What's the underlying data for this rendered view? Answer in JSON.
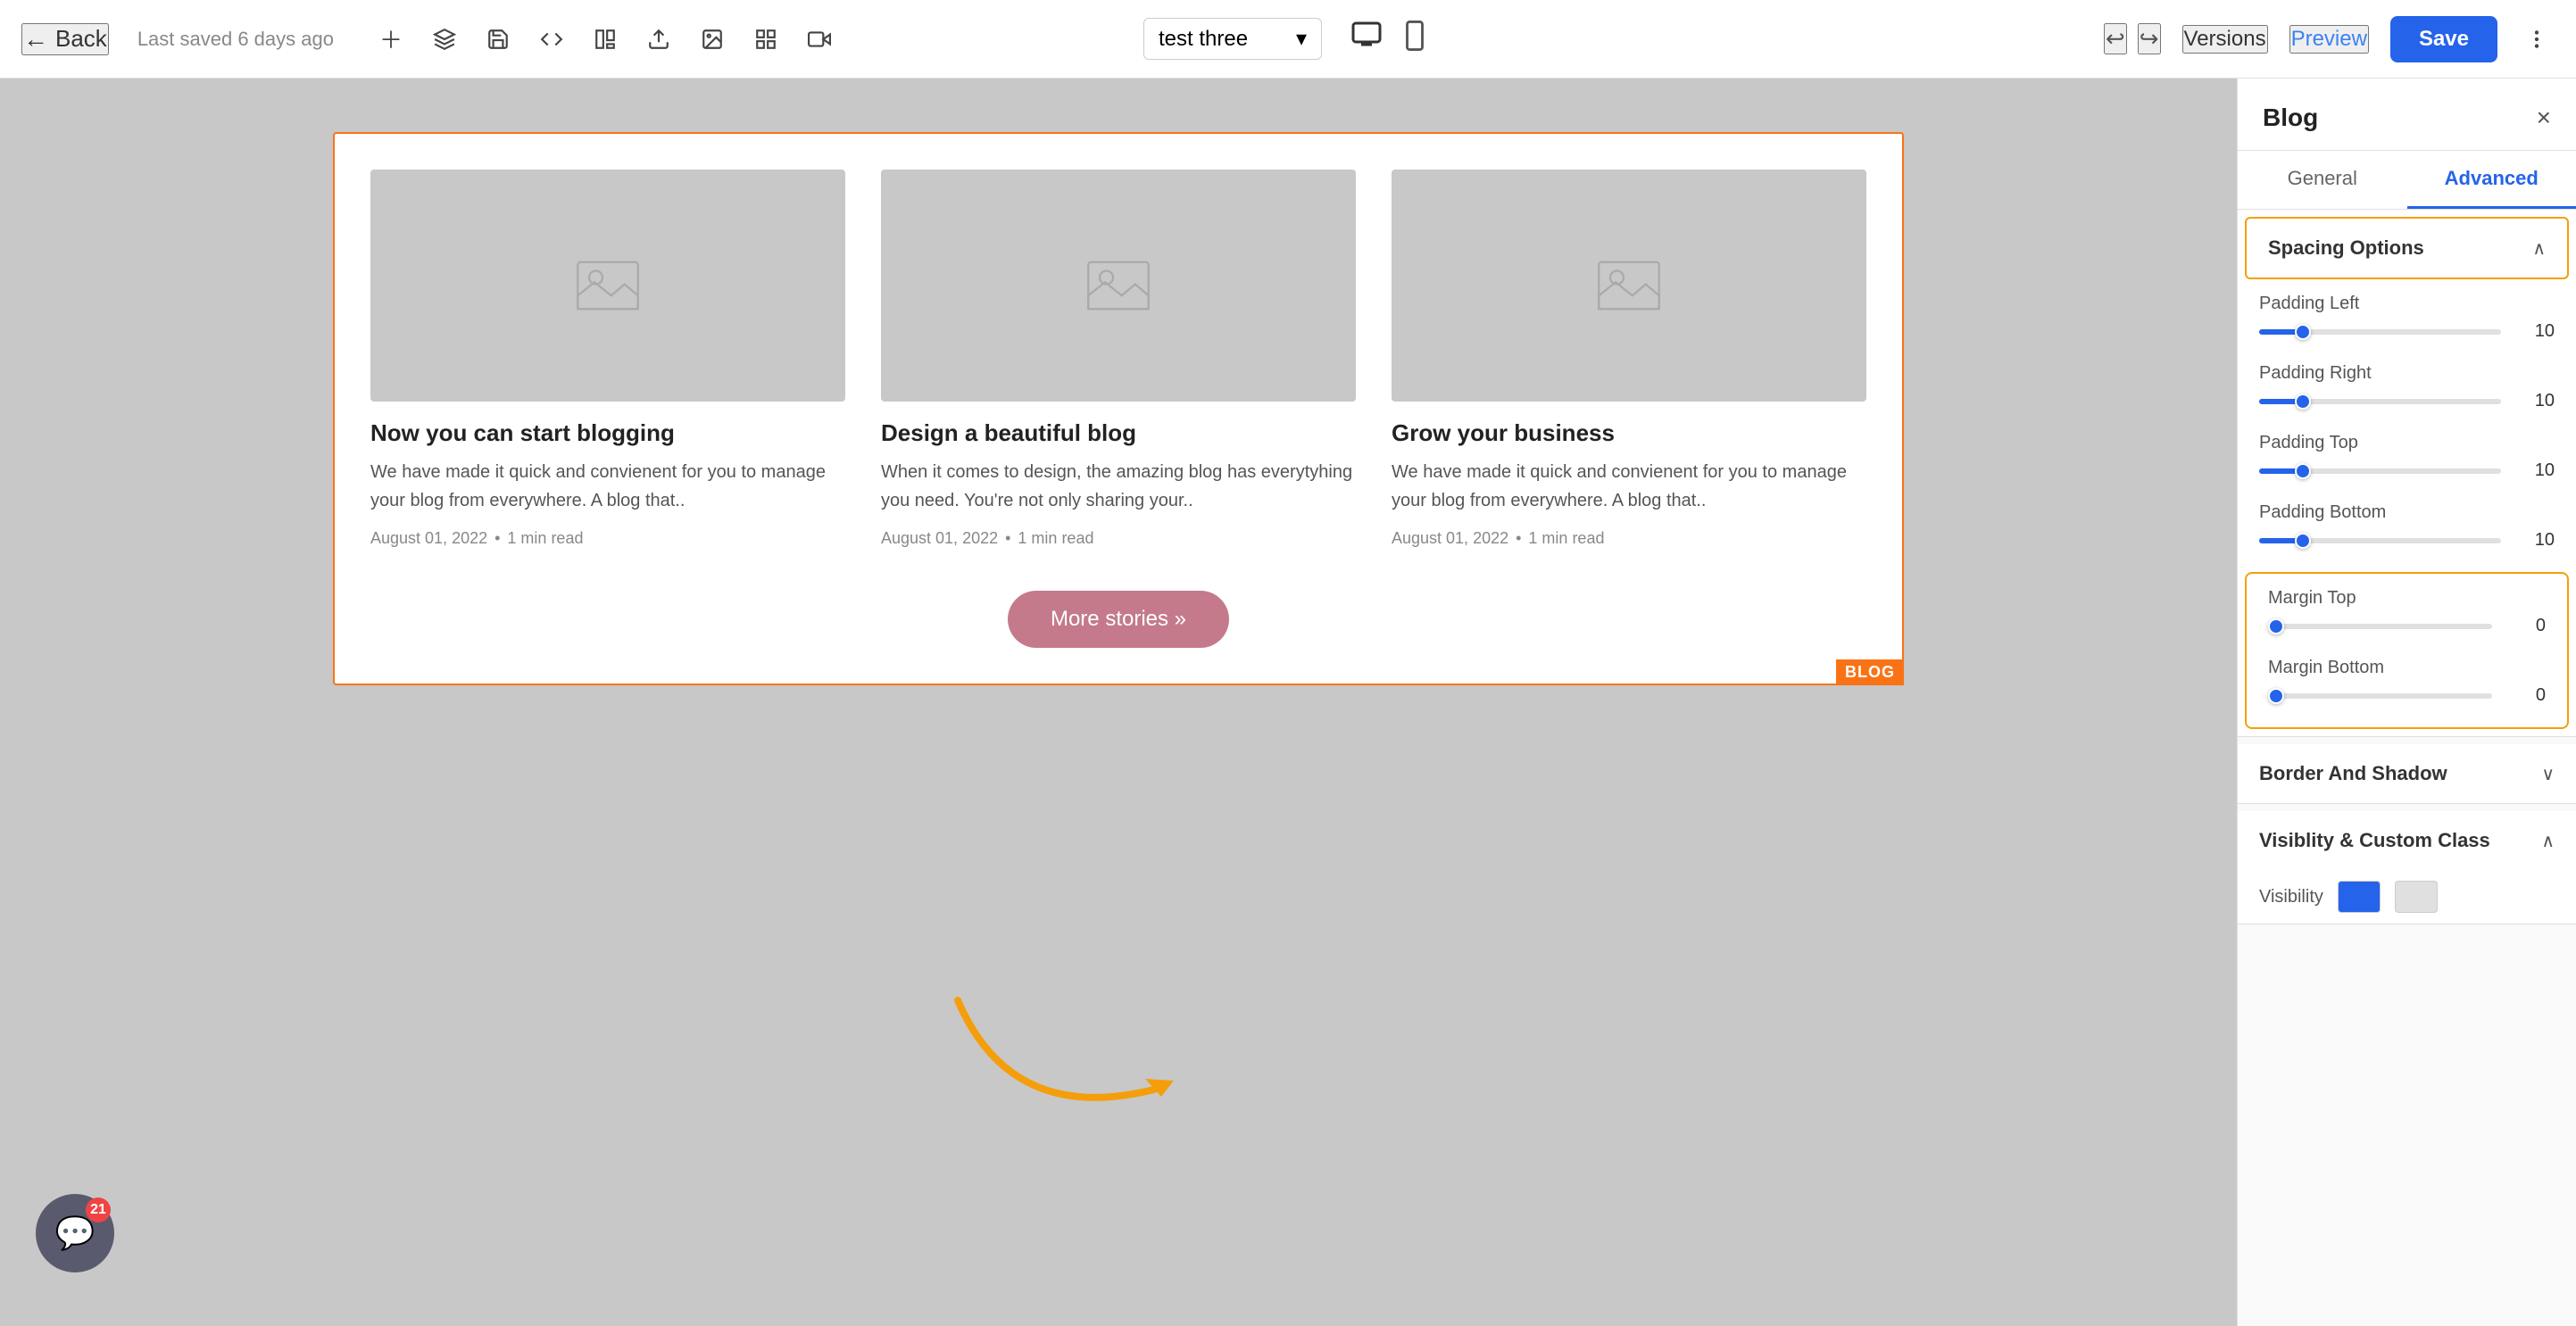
{
  "toolbar": {
    "back_label": "Back",
    "saved_text": "Last saved 6 days ago",
    "versions_label": "Versions",
    "preview_label": "Preview",
    "save_label": "Save",
    "page_name": "test three",
    "icons": [
      "plus",
      "layers",
      "save",
      "code",
      "template",
      "upload",
      "image",
      "grid",
      "media"
    ],
    "undo_label": "↩",
    "redo_label": "↪"
  },
  "canvas": {
    "blog_label": "BLOG",
    "cards": [
      {
        "title": "Now you can start blogging",
        "desc": "We have made it quick and convienent for you to manage your blog from everywhere. A blog that..",
        "date": "August 01, 2022",
        "read_time": "1 min read"
      },
      {
        "title": "Design a beautiful blog",
        "desc": "When it comes to design, the amazing blog has everytyhing you need. You're not only sharing your..",
        "date": "August 01, 2022",
        "read_time": "1 min read"
      },
      {
        "title": "Grow your business",
        "desc": "We have made it quick and convienent for you to manage your blog from everywhere. A blog that..",
        "date": "August 01, 2022",
        "read_time": "1 min read"
      }
    ],
    "more_stories": "More stories »"
  },
  "panel": {
    "title": "Blog",
    "close_label": "×",
    "tabs": [
      {
        "label": "General",
        "active": false
      },
      {
        "label": "Advanced",
        "active": true
      }
    ],
    "spacing_options_label": "Spacing Options",
    "padding_left_label": "Padding Left",
    "padding_left_value": "10",
    "padding_right_label": "Padding Right",
    "padding_right_value": "10",
    "padding_top_label": "Padding Top",
    "padding_top_value": "10",
    "padding_bottom_label": "Padding Bottom",
    "padding_bottom_value": "10",
    "margin_top_label": "Margin Top",
    "margin_top_value": "0",
    "margin_bottom_label": "Margin Bottom",
    "margin_bottom_value": "0",
    "border_shadow_label": "Border And Shadow",
    "visibility_label": "Visiblity & Custom Class",
    "visibility_sub_label": "Visibility"
  },
  "notification": {
    "count": "21"
  },
  "colors": {
    "accent_blue": "#2563eb",
    "accent_orange": "#f97316",
    "accent_yellow": "#f59e0b",
    "tab_active_blue": "#2563eb"
  }
}
